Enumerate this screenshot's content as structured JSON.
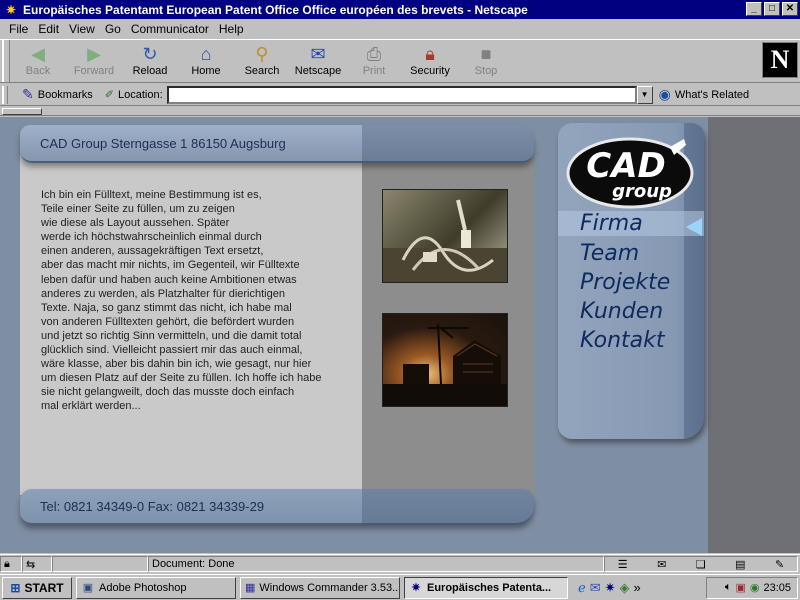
{
  "window": {
    "title": "Europäisches Patentamt European Patent Office Office européen des brevets - Netscape",
    "buttons": {
      "minimize": "_",
      "maximize": "□",
      "close": "✕"
    }
  },
  "menu": [
    "File",
    "Edit",
    "View",
    "Go",
    "Communicator",
    "Help"
  ],
  "toolbar": [
    {
      "label": "Back",
      "icon": "back-icon",
      "enabled": false
    },
    {
      "label": "Forward",
      "icon": "forward-icon",
      "enabled": false
    },
    {
      "label": "Reload",
      "icon": "reload-icon",
      "enabled": true
    },
    {
      "label": "Home",
      "icon": "home-icon",
      "enabled": true
    },
    {
      "label": "Search",
      "icon": "search-icon",
      "enabled": true
    },
    {
      "label": "Netscape",
      "icon": "netscape-icon",
      "enabled": true
    },
    {
      "label": "Print",
      "icon": "print-icon",
      "enabled": false
    },
    {
      "label": "Security",
      "icon": "security-icon",
      "enabled": true
    },
    {
      "label": "Stop",
      "icon": "stop-icon",
      "enabled": false
    }
  ],
  "brand_logo": "N",
  "location_bar": {
    "bookmarks_label": "Bookmarks",
    "location_label": "Location:",
    "url": "",
    "whats_related": "What's Related"
  },
  "page": {
    "header": "CAD Group  Sterngasse 1  86150 Augsburg",
    "footer": "Tel: 0821 34349-0 Fax: 0821 34339-29",
    "body_text": "Ich bin ein Fülltext, meine Bestimmung ist es,\nTeile einer Seite zu füllen, um zu zeigen\nwie diese als Layout aussehen. Später\nwerde ich höchstwahrscheinlich einmal durch\neinen anderen, aussagekräftigen Text ersetzt,\naber das macht mir nichts, im Gegenteil, wir Fülltexte\nleben dafür und haben auch keine Ambitionen etwas\nanderes zu werden, als Platzhalter für dierichtigen\nTexte. Naja, so ganz stimmt das nicht, ich habe mal\nvon anderen Fülltexten gehört, die befördert wurden\nund jetzt so richtig Sinn vermitteln, und die damit total\nglücklich sind. Vielleicht passiert mir das auch einmal,\nwäre klasse, aber bis dahin bin ich, wie gesagt, nur hier\num diesen Platz auf der Seite zu füllen. Ich hoffe ich habe\nsie nicht gelangweilt, doch das musste doch einfach\nmal erklärt werden...",
    "logo_top": "CAD",
    "logo_bottom": "group",
    "nav": [
      {
        "label": "Firma",
        "active": true
      },
      {
        "label": "Team",
        "active": false
      },
      {
        "label": "Projekte",
        "active": false
      },
      {
        "label": "Kunden",
        "active": false
      },
      {
        "label": "Kontakt",
        "active": false
      }
    ]
  },
  "status": {
    "text": "Document: Done"
  },
  "taskbar": {
    "start": "START",
    "tasks": [
      {
        "label": "Adobe Photoshop",
        "active": false
      },
      {
        "label": "Windows Commander 3.53...",
        "active": false
      },
      {
        "label": "Europäisches Patenta...",
        "active": true
      }
    ],
    "quick_more": "»",
    "clock": "23:05"
  },
  "colors": {
    "titlebar": "#000080",
    "header_bar": "#93a5bd",
    "nav_text": "#0f2a5e",
    "nav_arrow": "#9ad4ff"
  }
}
